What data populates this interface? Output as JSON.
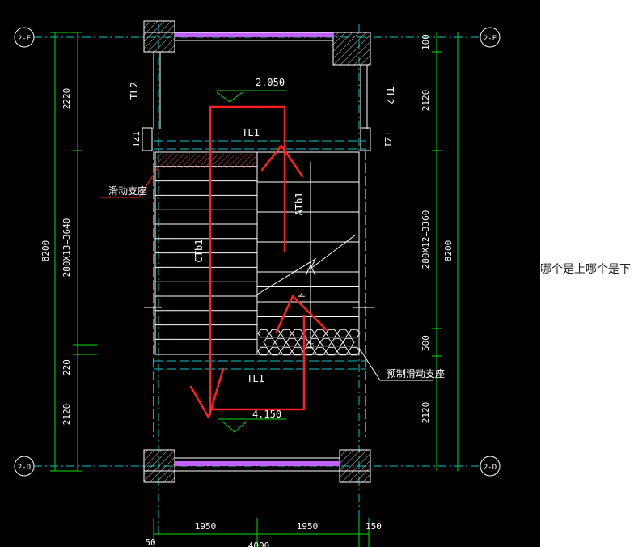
{
  "colors": {
    "background": "#000000",
    "dimension": "#00e000",
    "structure": "#ffffff",
    "axis": "#00c8c8",
    "wall_fill": "#c060ff",
    "markup": "#ff2020",
    "hatch": "#c04040",
    "text": "#ffffff"
  },
  "grid_axes": {
    "top_left": "2-E",
    "top_right": "2-E",
    "bottom_left": "2-D",
    "bottom_right": "2-D"
  },
  "elevations": {
    "top_landing": "2.050",
    "bottom_landing": "4.150"
  },
  "beams": {
    "top": "TL1",
    "bottom": "TL1",
    "left_col": "TL2",
    "right_col": "TL2",
    "tz_left": "TZ1",
    "tz_right": "TZ1"
  },
  "flights": {
    "left": "CTb1",
    "right": "ATb1"
  },
  "labels": {
    "sliding_support": "滑动支座",
    "embedded_sliding_support": "预制滑动支座",
    "down_mark": "下",
    "up_mark": "上"
  },
  "dimensions": {
    "left_top": "2220",
    "left_middle": "280X13=3640",
    "left_lower": "220",
    "left_bottom": "2120",
    "left_total": "8200",
    "right_top_small": "100",
    "right_top": "2120",
    "right_middle": "280X12=3360",
    "right_lower": "500",
    "right_bottom": "2120",
    "right_total": "8200",
    "bottom_left": "1950",
    "bottom_right": "1950",
    "bottom_edge": "150",
    "bottom_small": "50",
    "bottom_total": "4000"
  },
  "question": "哪个是上哪个是下"
}
